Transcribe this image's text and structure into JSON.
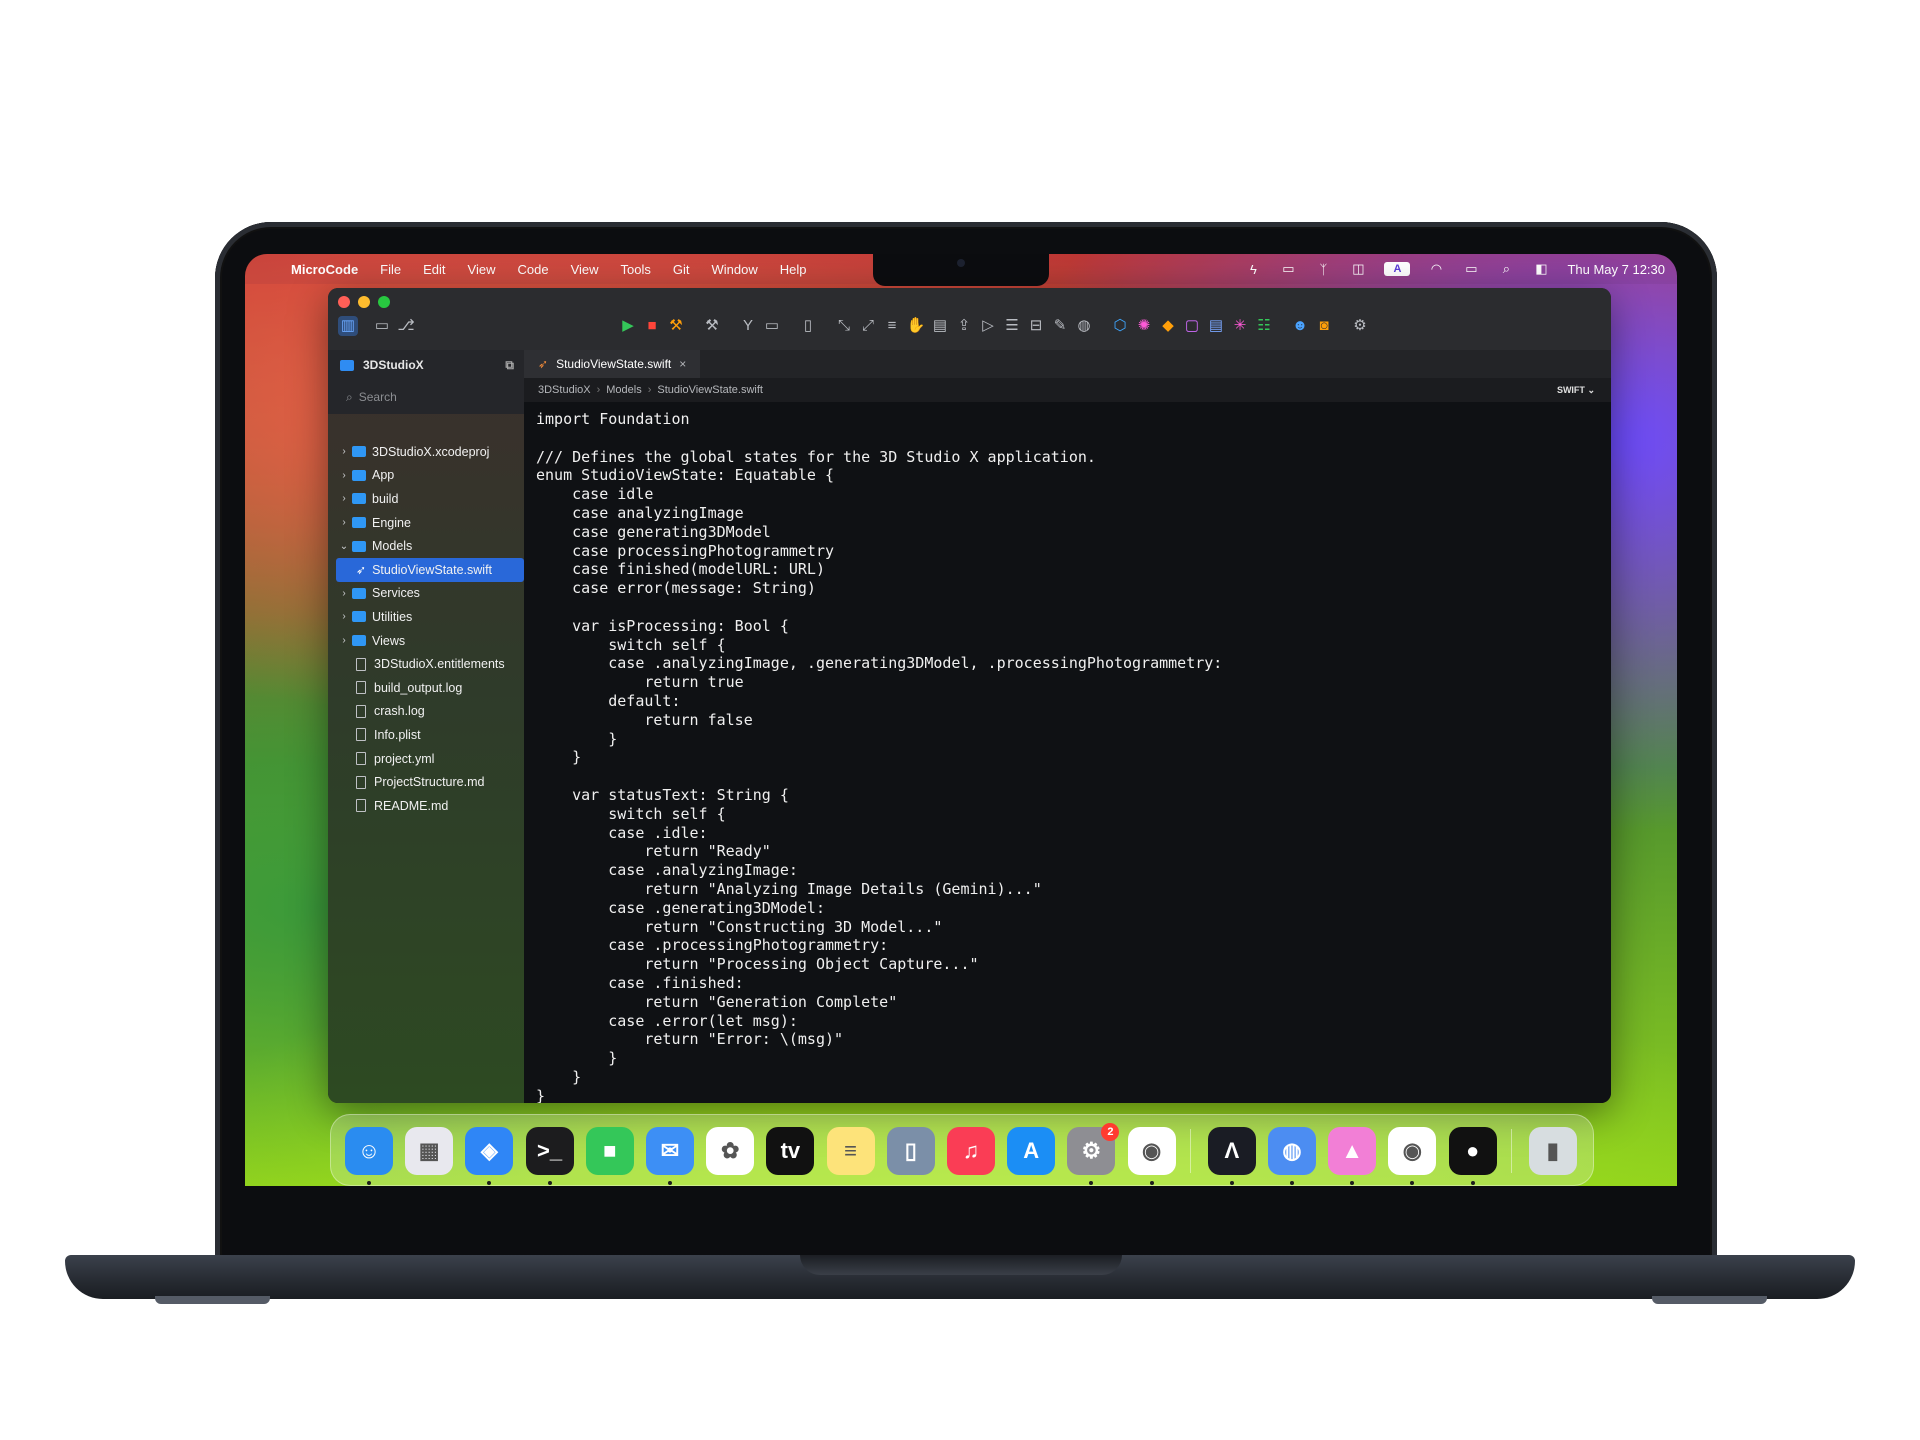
{
  "menubar": {
    "app_name": "MicroCode",
    "items": [
      "File",
      "Edit",
      "View",
      "Code",
      "View",
      "Tools",
      "Git",
      "Window",
      "Help"
    ],
    "clock": "Thu May 7  12:30",
    "keyboard_indicator": "A"
  },
  "toolbar": {
    "icons": [
      "sidebar-toggle-icon",
      "folder-icon",
      "source-control-icon",
      "run-icon",
      "stop-icon",
      "build-icon",
      "hammer-icon",
      "branch-icon",
      "terminal-icon",
      "device-icon",
      "tools-icon"
    ]
  },
  "sidebar": {
    "project_name": "3DStudioX",
    "search_placeholder": "Search",
    "items": [
      {
        "label": "3DStudioX.xcodeproj",
        "type": "folder",
        "expanded": false
      },
      {
        "label": "App",
        "type": "folder",
        "expanded": false
      },
      {
        "label": "build",
        "type": "folder",
        "expanded": false
      },
      {
        "label": "Engine",
        "type": "folder",
        "expanded": false
      },
      {
        "label": "Models",
        "type": "folder",
        "expanded": true
      },
      {
        "label": "StudioViewState.swift",
        "type": "swift",
        "selected": true
      },
      {
        "label": "Services",
        "type": "folder",
        "expanded": false
      },
      {
        "label": "Utilities",
        "type": "folder",
        "expanded": false
      },
      {
        "label": "Views",
        "type": "folder",
        "expanded": false
      },
      {
        "label": "3DStudioX.entitlements",
        "type": "file"
      },
      {
        "label": "build_output.log",
        "type": "file"
      },
      {
        "label": "crash.log",
        "type": "file"
      },
      {
        "label": "Info.plist",
        "type": "file"
      },
      {
        "label": "project.yml",
        "type": "file"
      },
      {
        "label": "ProjectStructure.md",
        "type": "file"
      },
      {
        "label": "README.md",
        "type": "file"
      }
    ]
  },
  "editor": {
    "tab_label": "StudioViewState.swift",
    "breadcrumb": [
      "3DStudioX",
      "Models",
      "StudioViewState.swift"
    ],
    "language": "SWIFT",
    "code": "import Foundation\n\n/// Defines the global states for the 3D Studio X application.\nenum StudioViewState: Equatable {\n    case idle\n    case analyzingImage\n    case generating3DModel\n    case processingPhotogrammetry\n    case finished(modelURL: URL)\n    case error(message: String)\n\n    var isProcessing: Bool {\n        switch self {\n        case .analyzingImage, .generating3DModel, .processingPhotogrammetry:\n            return true\n        default:\n            return false\n        }\n    }\n\n    var statusText: String {\n        switch self {\n        case .idle:\n            return \"Ready\"\n        case .analyzingImage:\n            return \"Analyzing Image Details (Gemini)...\"\n        case .generating3DModel:\n            return \"Constructing 3D Model...\"\n        case .processingPhotogrammetry:\n            return \"Processing Object Capture...\"\n        case .finished:\n            return \"Generation Complete\"\n        case .error(let msg):\n            return \"Error: \\(msg)\"\n        }\n    }\n}"
  },
  "dock": {
    "apps": [
      {
        "name": "finder-icon",
        "color": "#2a8cf0",
        "glyph": "☺",
        "running": true
      },
      {
        "name": "launchpad-icon",
        "color": "#e8e8ee",
        "glyph": "▦",
        "running": false
      },
      {
        "name": "safari-icon",
        "color": "#2f86f6",
        "glyph": "◈",
        "running": true
      },
      {
        "name": "terminal-icon",
        "color": "#1c1c1e",
        "glyph": ">_",
        "running": true
      },
      {
        "name": "facetime-icon",
        "color": "#34c759",
        "glyph": "■",
        "running": false
      },
      {
        "name": "mail-icon",
        "color": "#3d8ff5",
        "glyph": "✉",
        "running": true
      },
      {
        "name": "photos-icon",
        "color": "#ffffff",
        "glyph": "✿",
        "running": false
      },
      {
        "name": "appletv-icon",
        "color": "#111111",
        "glyph": "tv",
        "running": false
      },
      {
        "name": "notes-icon",
        "color": "#fde37a",
        "glyph": "≡",
        "running": false
      },
      {
        "name": "simulator-icon",
        "color": "#7b8fa8",
        "glyph": "▯",
        "running": false
      },
      {
        "name": "music-icon",
        "color": "#fa3d55",
        "glyph": "♫",
        "running": false
      },
      {
        "name": "appstore-icon",
        "color": "#1b8ef5",
        "glyph": "A",
        "running": false
      },
      {
        "name": "settings-icon",
        "color": "#8e8e93",
        "glyph": "⚙",
        "running": true,
        "badge": "2"
      },
      {
        "name": "chrome-icon",
        "color": "#ffffff",
        "glyph": "◉",
        "running": true
      },
      {
        "name": "instruments-icon",
        "color": "#1a1c24",
        "glyph": "Λ",
        "running": true
      },
      {
        "name": "db-icon",
        "color": "#4c8df2",
        "glyph": "◍",
        "running": true
      },
      {
        "name": "creative-icon",
        "color": "#f27fd6",
        "glyph": "▲",
        "running": true
      },
      {
        "name": "chrome-icon-2",
        "color": "#ffffff",
        "glyph": "◉",
        "running": true
      },
      {
        "name": "figma-icon",
        "color": "#111111",
        "glyph": "●",
        "running": true
      },
      {
        "name": "trash-icon",
        "color": "#d7dde0",
        "glyph": "▮",
        "running": false
      }
    ]
  }
}
